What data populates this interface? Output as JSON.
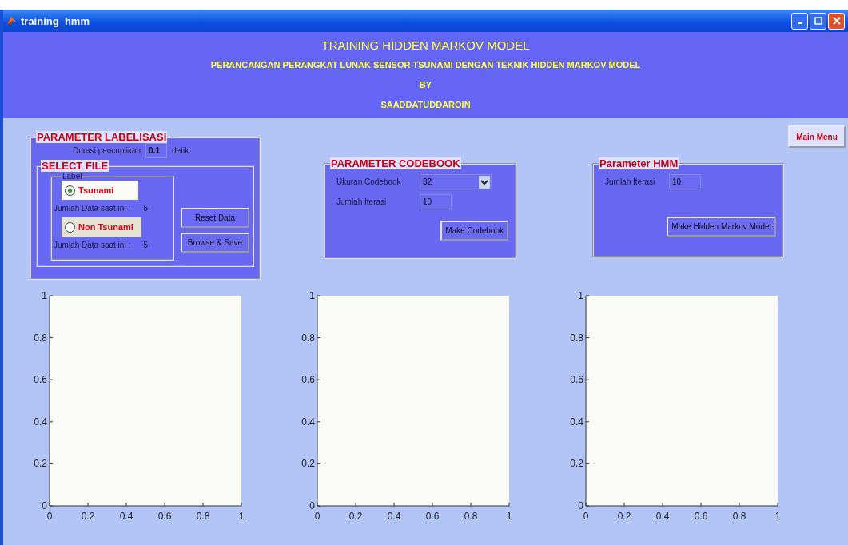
{
  "window": {
    "title": "training_hmm"
  },
  "header": {
    "lines": [
      "TRAINING HIDDEN MARKOV MODEL",
      "PERANCANGAN PERANGKAT LUNAK SENSOR TSUNAMI DENGAN TEKNIK HIDDEN MARKOV MODEL",
      "BY",
      "SAADDATUDDAROIN"
    ]
  },
  "labelisasi": {
    "title": "PARAMETER LABELISASI",
    "duration_label": "Durasi pencuplikan",
    "duration_value": "0.1",
    "duration_unit": "detik",
    "select_file": {
      "title": "SELECT FILE",
      "label_group": {
        "title": "Label",
        "options": [
          {
            "label": "Tsunami",
            "selected": true,
            "count_label": "Jumlah Data saat ini :",
            "count": "5"
          },
          {
            "label": "Non Tsunami",
            "selected": false,
            "count_label": "Jumlah Data saat ini :",
            "count": "5"
          }
        ]
      },
      "buttons": [
        "Reset Data",
        "Browse & Save"
      ]
    }
  },
  "codebook": {
    "title": "PARAMETER CODEBOOK",
    "fields": [
      {
        "kind": "dropdown",
        "label": "Ukuran Codebook",
        "value": "32"
      },
      {
        "kind": "input",
        "label": "Jumlah Iterasi",
        "value": "10"
      }
    ],
    "button": "Make Codebook"
  },
  "hmm": {
    "title": "Parameter HMM",
    "fields": [
      {
        "kind": "input",
        "label": "Jumlah Iterasi",
        "value": "10"
      }
    ],
    "button": "Make Hidden Markov Model"
  },
  "main_menu_button": "Main Menu",
  "charts": [
    {
      "chart_data": {
        "type": "line",
        "xlim": [
          0,
          1
        ],
        "ylim": [
          0,
          1
        ],
        "xticks": [
          0,
          0.2,
          0.4,
          0.6,
          0.8,
          1
        ],
        "yticks": [
          0,
          0.2,
          0.4,
          0.6,
          0.8,
          1
        ]
      }
    },
    {
      "chart_data": {
        "type": "line",
        "xlim": [
          0,
          1
        ],
        "ylim": [
          0,
          1
        ],
        "xticks": [
          0,
          0.2,
          0.4,
          0.6,
          0.8,
          1
        ],
        "yticks": [
          0,
          0.2,
          0.4,
          0.6,
          0.8,
          1
        ]
      }
    },
    {
      "chart_data": {
        "type": "line",
        "xlim": [
          0,
          1
        ],
        "ylim": [
          0,
          1
        ],
        "xticks": [
          0,
          0.2,
          0.4,
          0.6,
          0.8,
          1
        ],
        "yticks": [
          0,
          0.2,
          0.4,
          0.6,
          0.8,
          1
        ]
      }
    }
  ]
}
